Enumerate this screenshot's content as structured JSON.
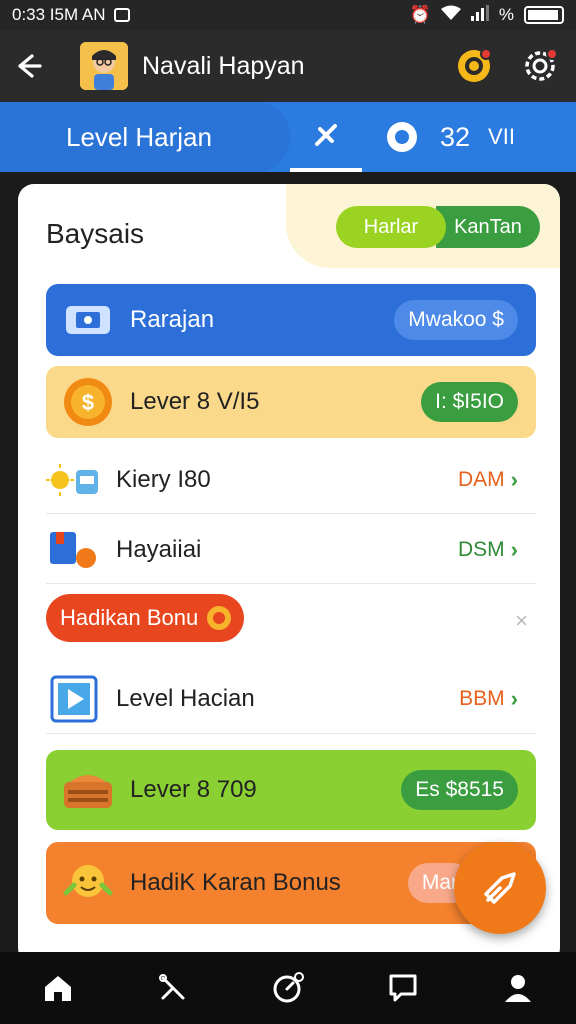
{
  "status_bar": {
    "time": "0:33 I5M AN",
    "battery_text": "%"
  },
  "app_bar": {
    "title": "Navali Hapyan"
  },
  "tab_bar": {
    "level_label": "Level Harjan",
    "count": "32",
    "unit": "VII"
  },
  "sheet": {
    "title": "Baysais",
    "toggle": {
      "option_a": "Harlar",
      "option_b": "KanTan"
    },
    "rows": [
      {
        "label": "Rarajan",
        "chip": "Mwakoo $",
        "color": "#2d6fd8"
      },
      {
        "label": "Lever 8 V/I5",
        "chip": "I: $I5IO",
        "color": "#fbd98b"
      },
      {
        "label": "Kiery I80",
        "right": "DAM",
        "right_color": "#e5611c"
      },
      {
        "label": "Hayaiiai",
        "right": "DSM",
        "right_color": "#2f8a34"
      },
      {
        "label": "Level Hacian",
        "right": "BBM",
        "right_color": "#e5611c"
      },
      {
        "label": "Lever 8 709",
        "chip": "Es $8515",
        "color": "#8bd033"
      },
      {
        "label": "HadiK Karan Bonus",
        "chip": "Mar",
        "color": "#f4812d"
      }
    ],
    "bonus_pill": {
      "label": "Hadikan Bonu"
    }
  },
  "colors": {
    "accent_blue": "#2b7be0",
    "green": "#3a9d3f",
    "orange": "#f07a1a"
  }
}
